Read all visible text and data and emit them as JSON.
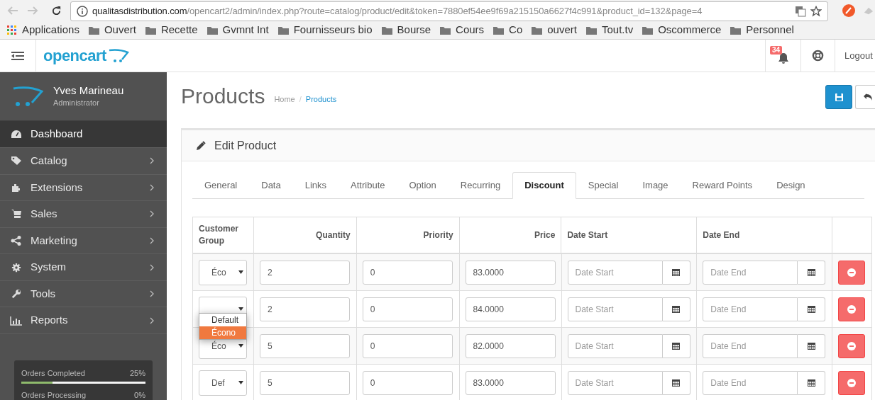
{
  "browser": {
    "url_host": "qualitasdistribution.com",
    "url_path": "/opencart2/admin/index.php?route=catalog/product/edit&token=7880ef54ee9f69a215150a6627f4c991&product_id=132&page=4",
    "bookmarks": [
      "Applications",
      "Ouvert",
      "Recette",
      "Gvmnt Int",
      "Fournisseurs bio",
      "Bourse",
      "Cours",
      "Co",
      "ouvert",
      "Tout.tv",
      "Oscommerce",
      "Personnel"
    ]
  },
  "header": {
    "logo": "opencart",
    "notification_count": "34",
    "logout": "Logout"
  },
  "sidebar": {
    "user_name": "Yves Marineau",
    "user_role": "Administrator",
    "items": [
      {
        "label": "Dashboard",
        "selected": true,
        "expandable": false
      },
      {
        "label": "Catalog",
        "selected": false,
        "expandable": true
      },
      {
        "label": "Extensions",
        "selected": false,
        "expandable": true
      },
      {
        "label": "Sales",
        "selected": false,
        "expandable": true
      },
      {
        "label": "Marketing",
        "selected": false,
        "expandable": true
      },
      {
        "label": "System",
        "selected": false,
        "expandable": true
      },
      {
        "label": "Tools",
        "selected": false,
        "expandable": true
      },
      {
        "label": "Reports",
        "selected": false,
        "expandable": true
      }
    ],
    "stats": [
      {
        "label": "Orders Completed",
        "value": "25%",
        "level": 0.25
      },
      {
        "label": "Orders Processing",
        "value": "0%"
      }
    ]
  },
  "page": {
    "title": "Products",
    "breadcrumb_separator": "/",
    "breadcrumb": [
      {
        "label": "Home",
        "current": false
      },
      {
        "label": "Products",
        "current": true
      }
    ]
  },
  "panel": {
    "title": "Edit Product",
    "tabs": [
      {
        "label": "General",
        "selected": false
      },
      {
        "label": "Data",
        "selected": false
      },
      {
        "label": "Links",
        "selected": false
      },
      {
        "label": "Attribute",
        "selected": false
      },
      {
        "label": "Option",
        "selected": false
      },
      {
        "label": "Recurring",
        "selected": false
      },
      {
        "label": "Discount",
        "selected": true
      },
      {
        "label": "Special",
        "selected": false
      },
      {
        "label": "Image",
        "selected": false
      },
      {
        "label": "Reward Points",
        "selected": false
      },
      {
        "label": "Design",
        "selected": false
      }
    ],
    "table": {
      "columns": [
        "Customer Group",
        "Quantity",
        "Priority",
        "Price",
        "Date Start",
        "Date End"
      ],
      "rows": [
        {
          "customer_group": "Éco",
          "quantity": "2",
          "priority": "0",
          "price": "83.0000",
          "date_start_placeholder": "Date Start",
          "date_end_placeholder": "Date End"
        },
        {
          "quantity": "2",
          "priority": "0",
          "price": "84.0000",
          "date_start_placeholder": "Date Start",
          "date_end_placeholder": "Date End"
        },
        {
          "customer_group": "Éco",
          "quantity": "5",
          "priority": "0",
          "price": "82.0000",
          "date_start_placeholder": "Date Start",
          "date_end_placeholder": "Date End"
        },
        {
          "customer_group": "Def",
          "quantity": "5",
          "priority": "0",
          "price": "83.0000",
          "date_start_placeholder": "Date Start",
          "date_end_placeholder": "Date End"
        }
      ]
    },
    "dropdown": {
      "options": [
        {
          "label": "Default",
          "selected": false
        },
        {
          "label": "Écono",
          "selected": true
        }
      ]
    }
  }
}
